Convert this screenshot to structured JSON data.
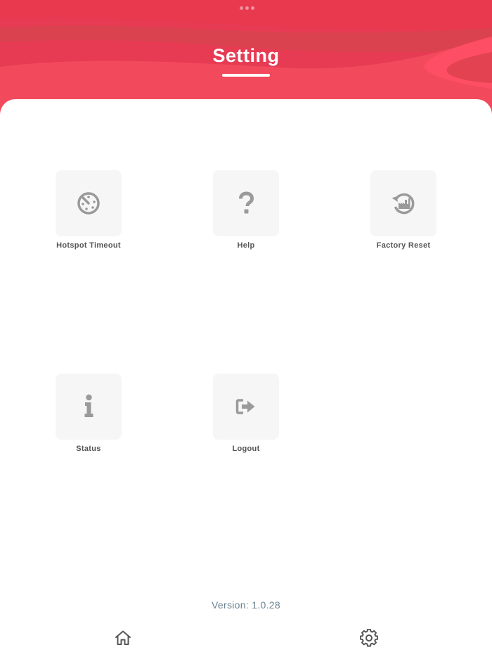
{
  "header": {
    "title": "Setting",
    "colors": {
      "primary": "#ea3f55",
      "light": "#f54a62",
      "dark": "#d9414f"
    }
  },
  "menu": {
    "items": [
      {
        "label": "Hotspot Timeout",
        "icon": "timer-icon"
      },
      {
        "label": "Help",
        "icon": "question-icon"
      },
      {
        "label": "Factory Reset",
        "icon": "factory-reset-icon"
      },
      {
        "label": "Status",
        "icon": "info-icon"
      },
      {
        "label": "Logout",
        "icon": "logout-icon"
      }
    ],
    "icon_color": "#9a9a9a",
    "tile_color": "#f6f6f6"
  },
  "footer": {
    "version": "Version: 1.0.28"
  },
  "bottom_nav": {
    "items": [
      {
        "icon": "home-icon"
      },
      {
        "icon": "gear-icon"
      }
    ],
    "icon_color": "#555555"
  }
}
